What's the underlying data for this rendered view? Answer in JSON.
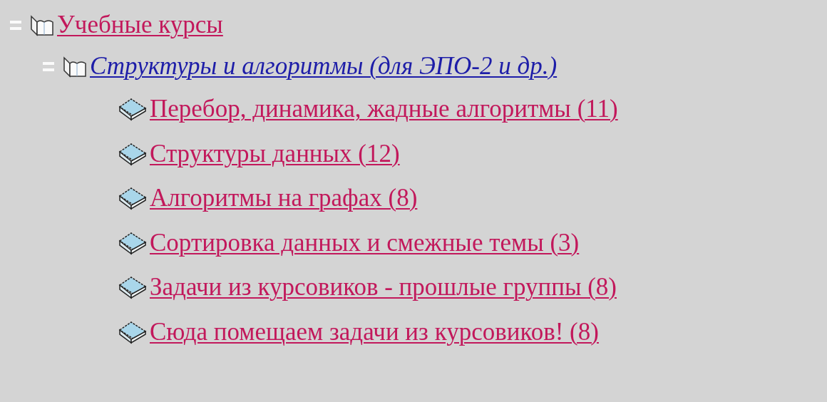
{
  "tree": [
    {
      "label": "Учебные курсы",
      "kind": "folder",
      "expanded": true,
      "selected": false,
      "children": [
        {
          "label": "Структуры и алгоритмы (для ЭПО-2 и др.)",
          "kind": "folder",
          "expanded": true,
          "selected": true,
          "children": [
            {
              "label": "Перебор, динамика, жадные алгоритмы (11)",
              "kind": "book",
              "selected": false
            },
            {
              "label": "Структуры данных (12)",
              "kind": "book",
              "selected": false
            },
            {
              "label": "Алгоритмы на графах (8)",
              "kind": "book",
              "selected": false
            },
            {
              "label": "Сортировка данных и смежные темы (3)",
              "kind": "book",
              "selected": false
            },
            {
              "label": "Задачи из курсовиков - прошлые группы (8)",
              "kind": "book",
              "selected": false
            },
            {
              "label": "Сюда помещаем задачи из курсовиков! (8)",
              "kind": "book",
              "selected": false
            }
          ]
        }
      ]
    }
  ]
}
